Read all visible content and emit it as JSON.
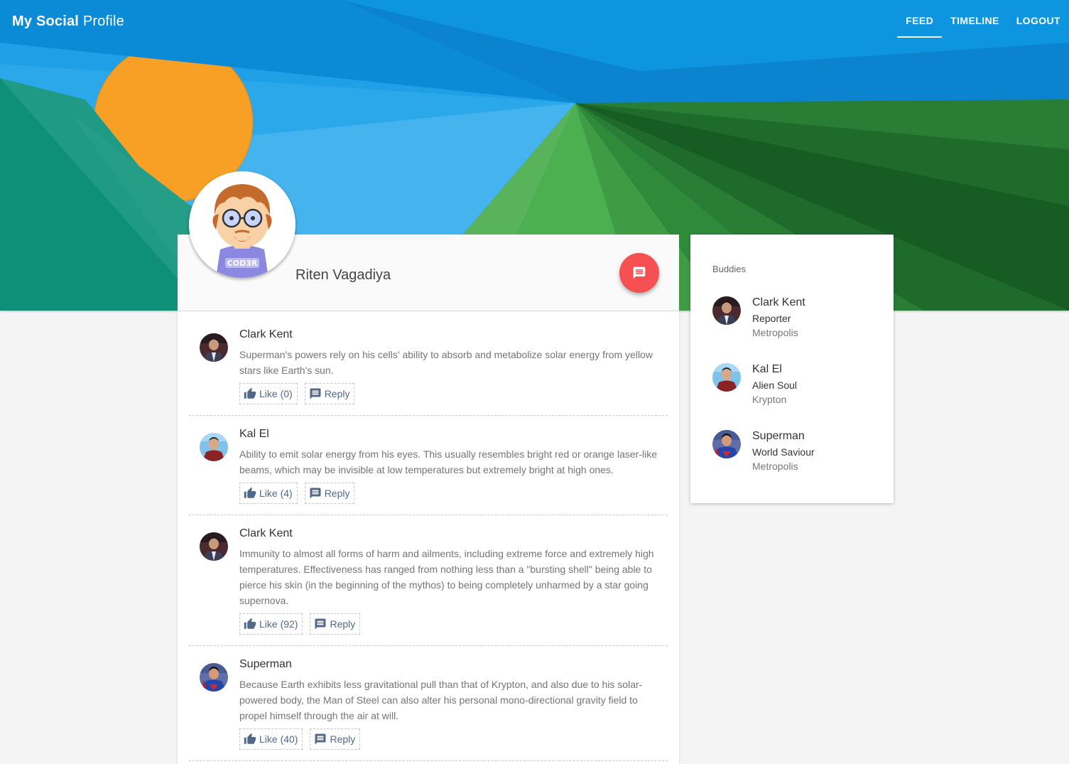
{
  "header": {
    "brand_bold": "My Social",
    "brand_light": "Profile",
    "nav": [
      {
        "label": "FEED",
        "active": true
      },
      {
        "label": "TIMELINE",
        "active": false
      },
      {
        "label": "LOGOUT",
        "active": false
      }
    ]
  },
  "profile": {
    "name": "Riten Vagadiya",
    "avatar_text": "COD3R",
    "message_icon": "message-icon"
  },
  "feed": {
    "posts": [
      {
        "author": "Clark Kent",
        "text": "Superman's powers rely on his cells' ability to absorb and metabolize solar energy from yellow stars like Earth's sun.",
        "like_label": "Like (0)",
        "reply_label": "Reply"
      },
      {
        "author": "Kal El",
        "text": "Ability to emit solar energy from his eyes. This usually resembles bright red or orange laser-like beams, which may be invisible at low temperatures but extremely bright at high ones.",
        "like_label": "Like (4)",
        "reply_label": "Reply"
      },
      {
        "author": "Clark Kent",
        "text": "Immunity to almost all forms of harm and ailments, including extreme force and extremely high temperatures. Effectiveness has ranged from nothing less than a \"bursting shell\" being able to pierce his skin (in the beginning of the mythos) to being completely unharmed by a star going supernova.",
        "like_label": "Like (92)",
        "reply_label": "Reply"
      },
      {
        "author": "Superman",
        "text": "Because Earth exhibits less gravitational pull than that of Krypton, and also due to his solar-powered body, the Man of Steel can also alter his personal mono-directional gravity field to propel himself through the air at will.",
        "like_label": "Like (40)",
        "reply_label": "Reply"
      }
    ]
  },
  "buddies": {
    "title": "Buddies",
    "items": [
      {
        "name": "Clark Kent",
        "role": "Reporter",
        "location": "Metropolis"
      },
      {
        "name": "Kal El",
        "role": "Alien Soul",
        "location": "Krypton"
      },
      {
        "name": "Superman",
        "role": "World Saviour",
        "location": "Metropolis"
      }
    ]
  },
  "colors": {
    "hero_blue": "#0a8fdc",
    "sun": "#f8a026",
    "fab": "#f75052",
    "action_text": "#52688a"
  }
}
